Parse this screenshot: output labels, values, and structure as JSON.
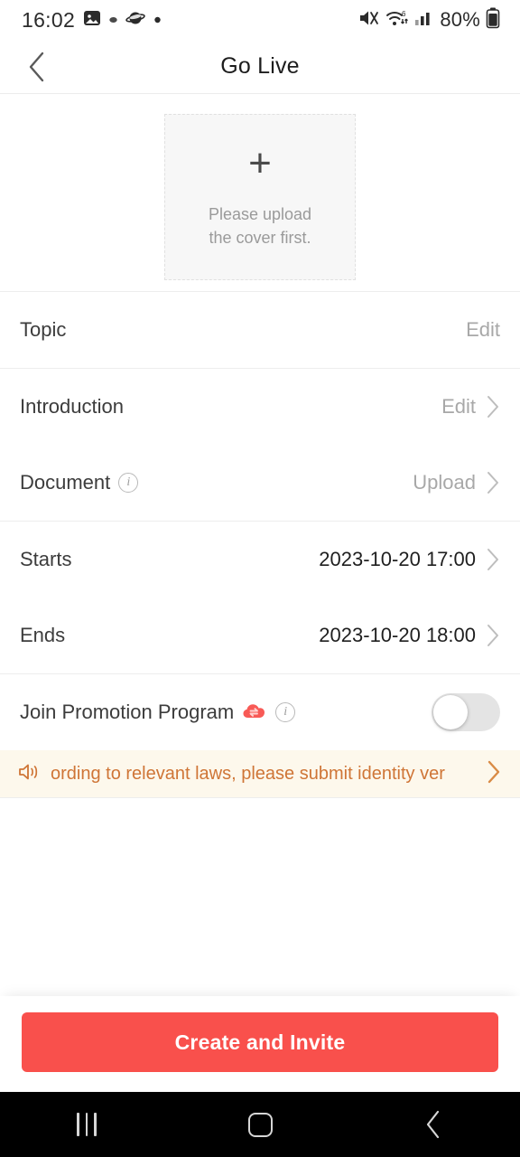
{
  "status_bar": {
    "time": "16:02",
    "battery_percent": "80%",
    "left_icons": [
      "image-icon",
      "dot-icon",
      "saturn-icon",
      "dot-icon"
    ],
    "right_icons": [
      "mute-icon",
      "wifi-6-icon",
      "cellular-signal-icon",
      "battery-icon"
    ]
  },
  "header": {
    "title": "Go Live",
    "back_icon": "chevron-left-icon"
  },
  "cover": {
    "plus": "+",
    "line1": "Please upload",
    "line2": "the cover first."
  },
  "rows": {
    "topic": {
      "label": "Topic",
      "action": "Edit"
    },
    "introduction": {
      "label": "Introduction",
      "action": "Edit"
    },
    "document": {
      "label": "Document",
      "action": "Upload",
      "info_icon": "info-icon"
    },
    "starts": {
      "label": "Starts",
      "value": "2023-10-20 17:00"
    },
    "ends": {
      "label": "Ends",
      "value": "2023-10-20 18:00"
    },
    "promotion": {
      "label": "Join Promotion Program",
      "badge_icon": "promotion-cloud-icon",
      "info_icon": "info-icon",
      "toggle_state": "off"
    }
  },
  "banner": {
    "icon": "megaphone-icon",
    "text": "ording to relevant laws, please submit identity ver",
    "chevron": "chevron-right-icon"
  },
  "bottom": {
    "cta_label": "Create and Invite"
  },
  "nav_bar": {
    "recents": "recents-icon",
    "home": "home-icon",
    "back": "back-icon"
  },
  "colors": {
    "accent": "#f9504c",
    "banner_bg": "#fdf8ec",
    "banner_text": "#cf7536",
    "toggle_off": "#e4e4e4"
  }
}
